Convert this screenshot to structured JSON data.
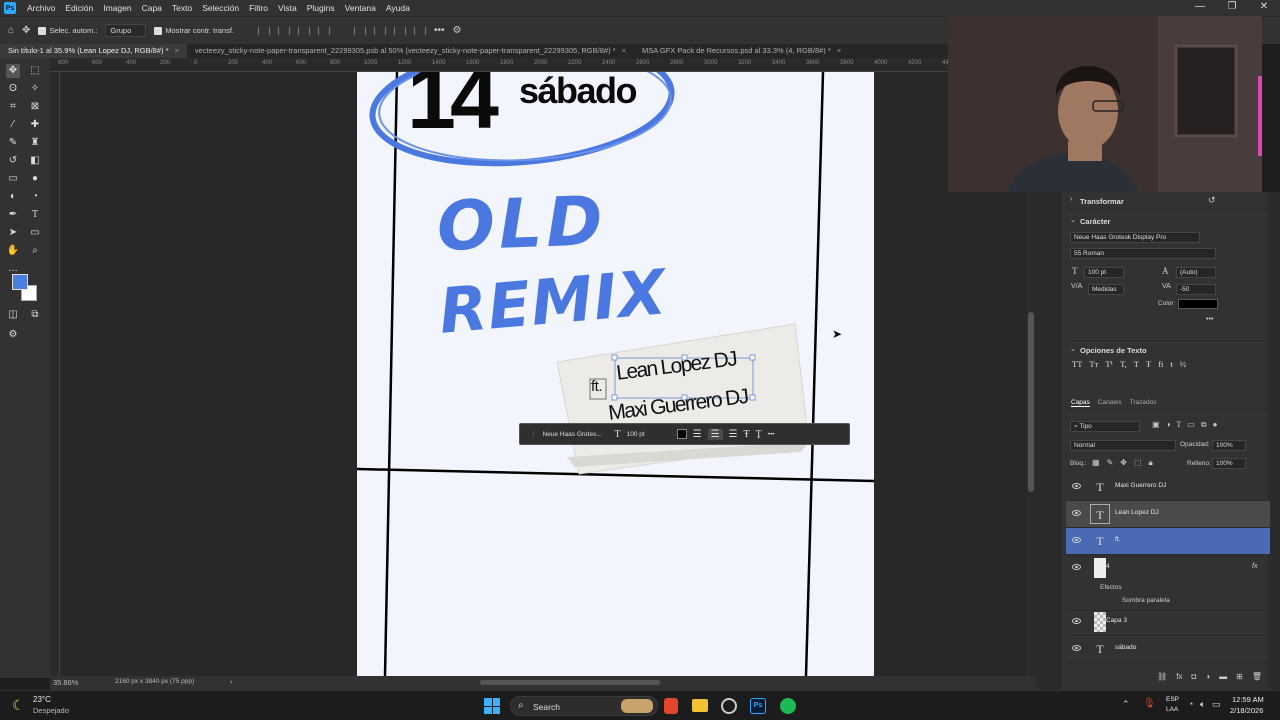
{
  "menubar": {
    "items": [
      "Archivo",
      "Edición",
      "Imagen",
      "Capa",
      "Texto",
      "Selección",
      "Filtro",
      "Vista",
      "Plugins",
      "Ventana",
      "Ayuda"
    ],
    "logo": "Ps"
  },
  "window_controls": {
    "minimize": "—",
    "restore": "❐",
    "close": "✕"
  },
  "options": {
    "auto_select_label": "Selec. autom.:",
    "auto_select_value": "Grupo",
    "show_transform_label": "Mostrar contr. transf.",
    "more": "•••"
  },
  "doc_tabs": [
    {
      "label": "Sin título-1 al 35.9% (Lean Lopez DJ, RGB/8#) *"
    },
    {
      "label": "vecteezy_sticky-note-paper-transparent_22299305.psb al 50% (vecteezy_sticky-note-paper-transparent_22299305, RGB/8#) *"
    },
    {
      "label": "MSA GFX Pack de Recursos.psd al 33.3% (4, RGB/8#) *"
    }
  ],
  "rulers": {
    "top": [
      "800",
      "600",
      "400",
      "200",
      "0",
      "200",
      "400",
      "600",
      "800",
      "1000",
      "1200",
      "1400",
      "1600",
      "1800",
      "2000",
      "2200",
      "2400",
      "2600",
      "2800",
      "3000",
      "3200",
      "3400",
      "3600",
      "3800",
      "4000",
      "4200",
      "4400"
    ]
  },
  "canvas": {
    "day_number": "14",
    "day_name": "sábado",
    "title_line1": "OLD",
    "title_line2": "REMIX",
    "ft_text": "ft.",
    "dj1": "Lean Lopez DJ",
    "dj2": "Maxi Guerrero DJ"
  },
  "context_bar": {
    "font": "Neue Haas Grotes...",
    "size": "100 pt",
    "more": "•••"
  },
  "status": {
    "zoom": "35.86%",
    "doc_size": "2160 px x 3840 px (75 ppp)"
  },
  "properties": {
    "transform_header": "Transformar",
    "character_header": "Carácter",
    "font_family": "Neue Haas Grotesk Display Pro",
    "font_style": "55 Roman",
    "font_size": "100 pt",
    "leading": "(Auto)",
    "kerning": "Medidas",
    "tracking": "-50",
    "color_label": "Color",
    "color_value": "#000000",
    "more": "•••",
    "text_options_header": "Opciones de Texto",
    "text_style_glyphs": [
      "TT",
      "Tт",
      "T¹",
      "T,",
      "T",
      "Ŧ",
      "fi",
      "ŧ",
      "½"
    ]
  },
  "layers_panel": {
    "tabs": [
      "Capas",
      "Canales",
      "Trazados"
    ],
    "filter_label": "Tipo",
    "blend_mode": "Normal",
    "opacity_label": "Opacidad:",
    "opacity_value": "100%",
    "lock_label": "Bloq.:",
    "fill_label": "Relleno:",
    "fill_value": "100%",
    "layers": [
      {
        "name": "Maxi Guerrero DJ",
        "type": "T"
      },
      {
        "name": "Lean Lopez DJ",
        "type": "T"
      },
      {
        "name": "ft.",
        "type": "T"
      },
      {
        "name": "4",
        "type": "img",
        "fx": "fx"
      },
      {
        "name": "Capa 3",
        "type": "img"
      },
      {
        "name": "sábado",
        "type": "T"
      }
    ],
    "effects_label": "Efectos",
    "effect_name": "Sombra paralela"
  },
  "taskbar": {
    "temperature": "23°C",
    "weather": "Despejado",
    "search": "Search",
    "lang1": "ESP",
    "lang2": "LAA",
    "time": "12:59 AM",
    "date": "2/18/2026"
  },
  "colors": {
    "accent": "#4a6ab3",
    "foreground_swatch": "#4a7fe0",
    "scribble_blue": "#4a78e0",
    "canvas_bg": "#f2f5fd"
  }
}
